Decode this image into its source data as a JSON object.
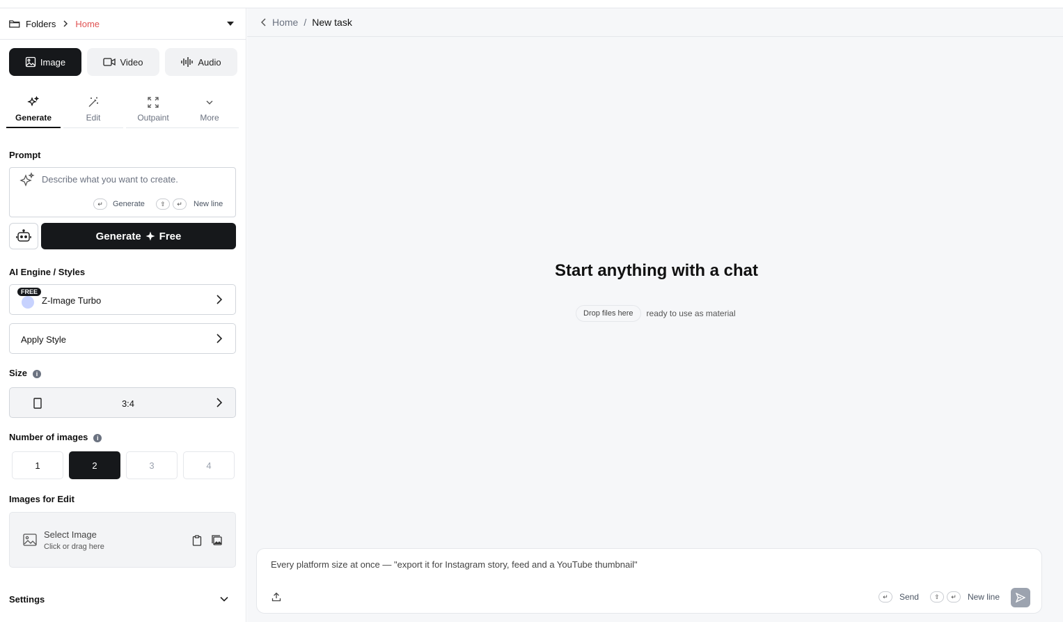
{
  "sidebar": {
    "folders_label": "Folders",
    "home_label": "Home",
    "media_tabs": [
      {
        "label": "Image",
        "icon": "image-icon"
      },
      {
        "label": "Video",
        "icon": "video-icon"
      },
      {
        "label": "Audio",
        "icon": "audio-icon"
      }
    ],
    "sub_tabs": [
      {
        "label": "Generate",
        "icon": "sparkle-icon"
      },
      {
        "label": "Edit",
        "icon": "magic-wand-icon"
      },
      {
        "label": "Outpaint",
        "icon": "expand-icon"
      },
      {
        "label": "More",
        "icon": "chevron-down-icon"
      }
    ],
    "prompt": {
      "label": "Prompt",
      "placeholder": "Describe what you want to create.",
      "hint_generate": "Generate",
      "hint_newline": "New line"
    },
    "generate_button": {
      "label": "Generate",
      "suffix": "Free"
    },
    "engine": {
      "label": "AI Engine / Styles",
      "badge": "FREE",
      "name": "Z-Image Turbo",
      "style_label": "Apply Style"
    },
    "size": {
      "label": "Size",
      "value": "3:4"
    },
    "count": {
      "label": "Number of images",
      "options": [
        "1",
        "2",
        "3",
        "4"
      ],
      "selected": "2"
    },
    "images_for_edit": {
      "label": "Images for Edit",
      "title": "Select Image",
      "subtitle": "Click or drag here"
    },
    "settings_label": "Settings"
  },
  "main": {
    "breadcrumb": {
      "home": "Home",
      "separator": "/",
      "current": "New task"
    },
    "hero_title": "Start anything with a chat",
    "drop_chip": "Drop files here",
    "drop_text": "ready to use as material",
    "chat": {
      "placeholder": "Every platform size at once — \"export it for Instagram story, feed and a YouTube thumbnail\"",
      "hint_send": "Send",
      "hint_newline": "New line"
    }
  },
  "colors": {
    "accent_dark": "#16181b",
    "home_link": "#e05252",
    "main_bg": "#f6f7f9"
  }
}
